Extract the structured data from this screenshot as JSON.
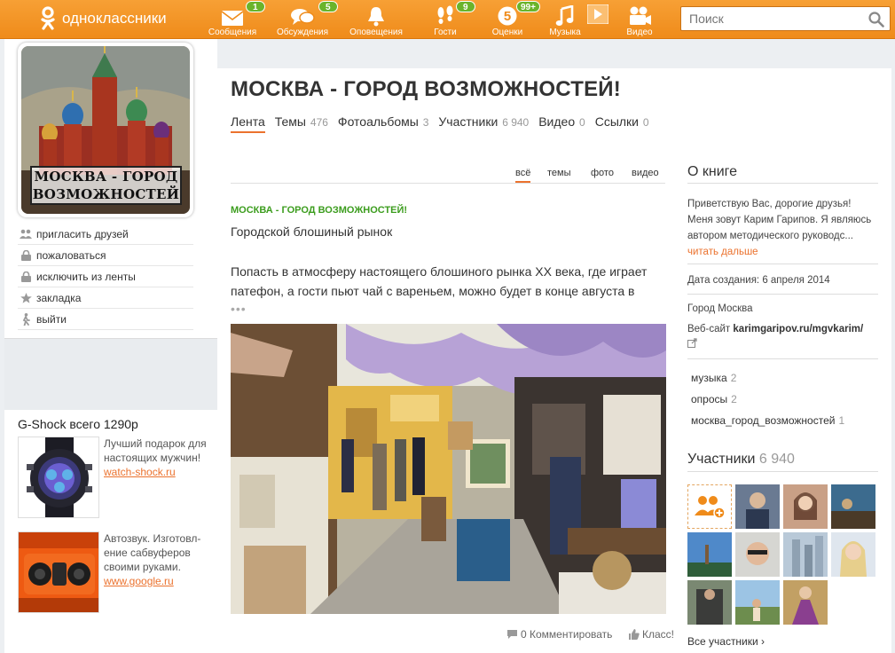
{
  "brand": {
    "name": "одноклассники"
  },
  "nav": [
    {
      "label": "Сообщения",
      "icon": "envelope-icon",
      "badge": "1"
    },
    {
      "label": "Обсуждения",
      "icon": "chat-bubbles-icon",
      "badge": "5"
    },
    {
      "label": "Оповещения",
      "icon": "bell-icon",
      "badge": ""
    },
    {
      "label": "Гости",
      "icon": "footprints-icon",
      "badge": "9"
    },
    {
      "label": "Оценки",
      "icon": "rating-five-icon",
      "badge": "99+"
    },
    {
      "label": "Музыка",
      "icon": "music-note-icon",
      "badge": ""
    },
    {
      "label": "Видео",
      "icon": "video-camera-icon",
      "badge": ""
    }
  ],
  "search": {
    "placeholder": "Поиск"
  },
  "group": {
    "title": "МОСКВА - ГОРОД ВОЗМОЖНОСТЕЙ!",
    "avatar_caption_line1": "МОСКВА - ГОРОД",
    "avatar_caption_line2": "ВОЗМОЖНОСТЕЙ"
  },
  "tabs": [
    {
      "label": "Лента",
      "count": ""
    },
    {
      "label": "Темы",
      "count": "476"
    },
    {
      "label": "Фотоальбомы",
      "count": "3"
    },
    {
      "label": "Участники",
      "count": "6 940"
    },
    {
      "label": "Видео",
      "count": "0"
    },
    {
      "label": "Ссылки",
      "count": "0"
    }
  ],
  "actions": [
    {
      "label": "пригласить друзей",
      "icon": "people-icon"
    },
    {
      "label": "пожаловаться",
      "icon": "lock-icon"
    },
    {
      "label": "исключить из ленты",
      "icon": "lock-icon"
    },
    {
      "label": "закладка",
      "icon": "star-icon"
    },
    {
      "label": "выйти",
      "icon": "walking-person-icon"
    }
  ],
  "ads": {
    "title": "G-Shock всего 1290р",
    "items": [
      {
        "text": "Лучший подарок для настоящих мужчин!",
        "link": "watch-shock.ru"
      },
      {
        "text": "Автозвук. Изготовл-ение сабвуферов своими руками.",
        "link": "www.google.ru"
      }
    ]
  },
  "filters": [
    "всё",
    "темы",
    "фото",
    "видео"
  ],
  "post": {
    "group_name": "МОСКВА - ГОРОД ВОЗМОЖНОСТЕЙ!",
    "subtitle": "Городской блошиный рынок",
    "text": "Попасть в атмосферу настоящего блошиного рынка XX века, где играет патефон, а гости пьют чай с вареньем, можно будет в конце августа в",
    "more": "•••",
    "comments": "0 Комментировать",
    "likes": "Класс!"
  },
  "about": {
    "heading": "О книге",
    "description": "Приветствую Вас,  дорогие друзья! Меня зовут Карим Гарипов. Я являюсь автором методического руководс...",
    "read_more": "читать дальше",
    "created": "Дата создания: 6 апреля 2014",
    "city": "Город Москва",
    "website_label": "Веб-сайт",
    "website": "karimgaripov.ru/mgvkarim/"
  },
  "tags": [
    {
      "label": "музыка",
      "count": "2"
    },
    {
      "label": "опросы",
      "count": "2"
    },
    {
      "label": "москва_город_возможностей",
      "count": "1"
    }
  ],
  "members": {
    "heading": "Участники",
    "count": "6 940",
    "all_label": "Все участники ›"
  },
  "colors": {
    "brand_orange": "#ef8b1a",
    "accent": "#eb722e",
    "badge_green": "#6ab42b",
    "post_group_green": "#3c9d1e"
  }
}
